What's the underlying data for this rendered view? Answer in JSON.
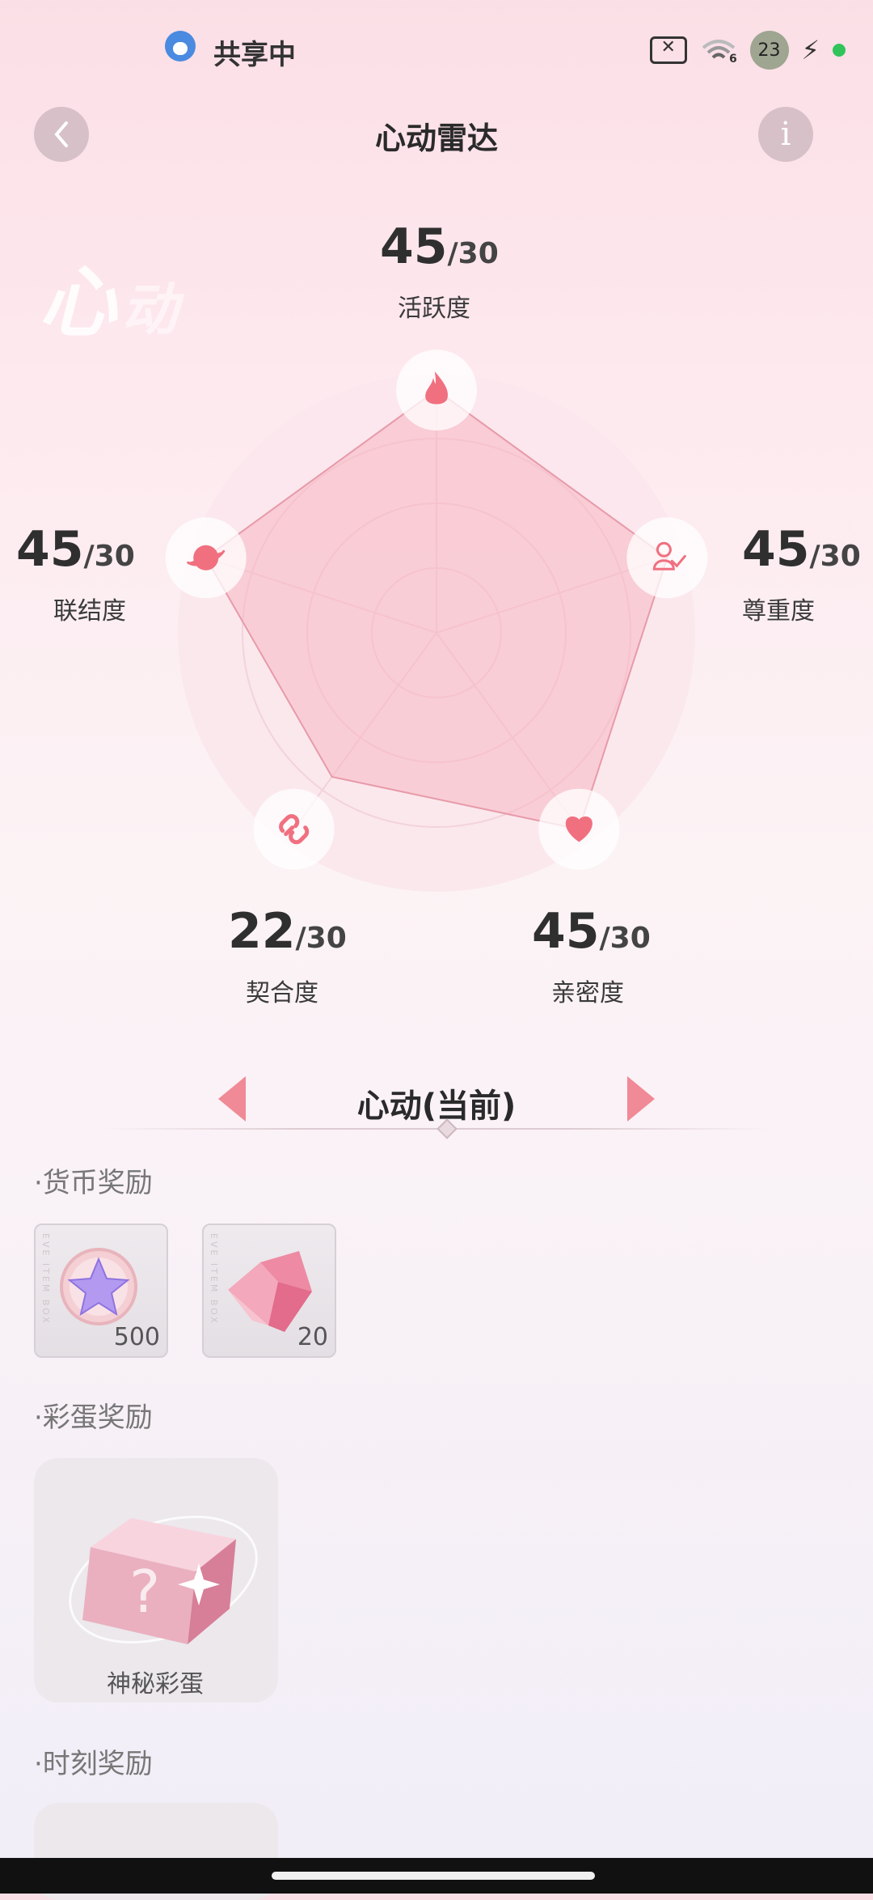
{
  "status_bar": {
    "app_label": "共享中",
    "wifi_label": "6",
    "badge": "23"
  },
  "header": {
    "title": "心动雷达",
    "back_icon": "chevron-left-icon",
    "info_label": "i"
  },
  "watermark": {
    "main": "心",
    "sub": "动"
  },
  "radar": {
    "max": 30,
    "axes": [
      {
        "key": "activity",
        "label": "活跃度",
        "value": "45",
        "max_text": "/30",
        "icon": "flame-icon",
        "v": 45
      },
      {
        "key": "respect",
        "label": "尊重度",
        "value": "45",
        "max_text": "/30",
        "icon": "person-check-icon",
        "v": 45
      },
      {
        "key": "intimacy",
        "label": "亲密度",
        "value": "45",
        "max_text": "/30",
        "icon": "hearts-icon",
        "v": 45
      },
      {
        "key": "fit",
        "label": "契合度",
        "value": "22",
        "max_text": "/30",
        "icon": "link-icon",
        "v": 22
      },
      {
        "key": "connection",
        "label": "联结度",
        "value": "45",
        "max_text": "/30",
        "icon": "planet-icon",
        "v": 45
      }
    ],
    "colors": {
      "fill": "#f7b6c3",
      "stroke": "#e79aa9",
      "icon": "#f0707f",
      "ring": "#ffffff"
    }
  },
  "level": {
    "label": "心动(当前)"
  },
  "sections": {
    "currency": {
      "title": "·货币奖励",
      "items": [
        {
          "name": "star-coin",
          "quantity": "500"
        },
        {
          "name": "pink-crystal",
          "quantity": "20"
        }
      ]
    },
    "easter_egg": {
      "title": "·彩蛋奖励",
      "item_label": "神秘彩蛋"
    },
    "moment": {
      "title": "·时刻奖励"
    }
  }
}
